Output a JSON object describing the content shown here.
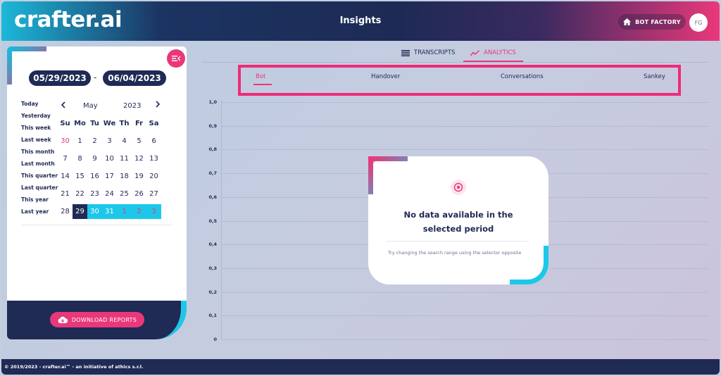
{
  "header": {
    "logo": "crafter.ai",
    "title": "Insights",
    "bot_factory_label": "BOT FACTORY",
    "avatar_initials": "FG"
  },
  "sidebar": {
    "date_from": "05/29/2023",
    "date_separator": "-",
    "date_to": "06/04/2023",
    "quick_ranges": [
      "Today",
      "Yesterday",
      "This week",
      "Last week",
      "This month",
      "Last month",
      "This quarter",
      "Last quarter",
      "This year",
      "Last year"
    ],
    "calendar": {
      "month": "May",
      "year": "2023",
      "weekdays": [
        "Su",
        "Mo",
        "Tu",
        "We",
        "Th",
        "Fr",
        "Sa"
      ],
      "weeks": [
        [
          "30",
          "1",
          "2",
          "3",
          "4",
          "5",
          "6"
        ],
        [
          "7",
          "8",
          "9",
          "10",
          "11",
          "12",
          "13"
        ],
        [
          "14",
          "15",
          "16",
          "17",
          "18",
          "19",
          "20"
        ],
        [
          "21",
          "22",
          "23",
          "24",
          "25",
          "26",
          "27"
        ],
        [
          "28",
          "29",
          "30",
          "31",
          "1",
          "2",
          "3"
        ]
      ]
    },
    "download_label": "DOWNLOAD REPORTS"
  },
  "tabs": {
    "transcripts": "TRANSCRIPTS",
    "analytics": "ANALYTICS"
  },
  "subtabs": [
    "Bot",
    "Handover",
    "Conversations",
    "Sankey"
  ],
  "y_axis": [
    "1,0",
    "0,9",
    "0,8",
    "0,7",
    "0,6",
    "0,5",
    "0,4",
    "0,3",
    "0,2",
    "0,1",
    "0"
  ],
  "empty_state": {
    "title": "No data available in the selected period",
    "hint": "Try changing the search range using the selector opposite"
  },
  "footer": {
    "text": "© 2019/2023 - crafter.ai™ - an initiative of athics s.r.l."
  },
  "colors": {
    "navy": "#1f2a55",
    "pink": "#e9387a",
    "cyan": "#1cc8ea"
  }
}
